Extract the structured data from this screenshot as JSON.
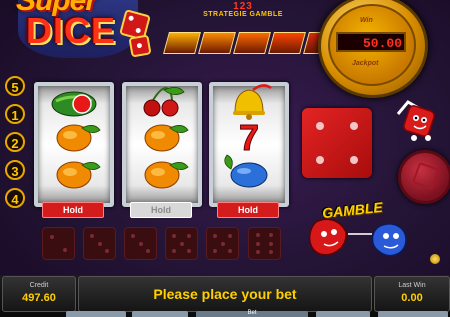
{
  "logo": {
    "line1": "Super",
    "line2": "DICE"
  },
  "strategy": {
    "numbers": "123",
    "text": "STRATEGIE GAMBLE"
  },
  "meter": {
    "top_label": "Win",
    "display": "50.00",
    "bottom_label": "Jackpot"
  },
  "step_colors": [
    "#ffb000",
    "#ff8a00",
    "#ff6a00",
    "#ff4500",
    "#e02a10",
    "#c81a10"
  ],
  "side_numbers": [
    "5",
    "1",
    "2",
    "3",
    "4"
  ],
  "reels": [
    {
      "symbols": [
        "watermelon",
        "orange",
        "orange"
      ],
      "hold": "Hold",
      "hold_active": true
    },
    {
      "symbols": [
        "cherries",
        "orange",
        "orange"
      ],
      "hold": "Hold",
      "hold_active": false
    },
    {
      "symbols": [
        "bell",
        "seven",
        "plum"
      ],
      "hold": "Hold",
      "hold_active": true
    }
  ],
  "big_die_value": 4,
  "small_dice": [
    2,
    3,
    3,
    5,
    5,
    6
  ],
  "gamble": {
    "label": "GAMBLE"
  },
  "credit": {
    "label": "Credit",
    "value": "497.60"
  },
  "message": "Please place your bet",
  "last_win": {
    "label": "Last Win",
    "value": "0.00"
  },
  "bet_tab_label": "Bet"
}
